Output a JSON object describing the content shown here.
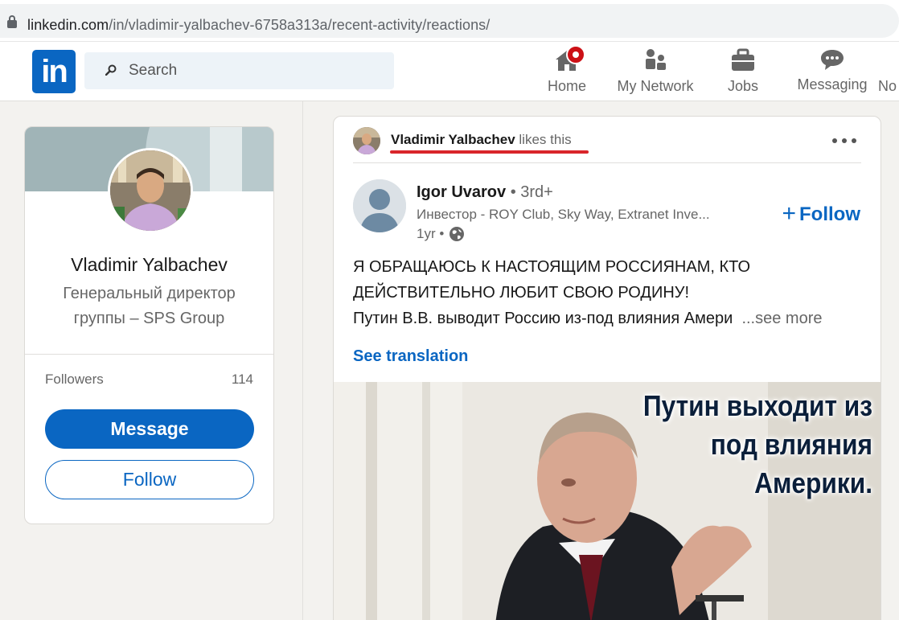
{
  "browser": {
    "url_host": "linkedin.com",
    "url_path": "/in/vladimir-yalbachev-6758a313a/recent-activity/reactions/"
  },
  "nav": {
    "logo_text": "in",
    "search_placeholder": "Search",
    "items": [
      {
        "label": "Home",
        "icon": "home-icon",
        "has_badge": true
      },
      {
        "label": "My Network",
        "icon": "people-icon"
      },
      {
        "label": "Jobs",
        "icon": "briefcase-icon"
      },
      {
        "label": "Messaging",
        "icon": "chat-icon"
      },
      {
        "label": "No",
        "icon": "bell-icon"
      }
    ]
  },
  "profile": {
    "name": "Vladimir Yalbachev",
    "headline": "Генеральный директор группы – SPS Group",
    "followers_label": "Followers",
    "followers_count": "114",
    "message_button": "Message",
    "follow_button": "Follow"
  },
  "post": {
    "context_name": "Vladimir Yalbachev",
    "context_action": "likes this",
    "actor_name": "Igor Uvarov",
    "actor_degree": "• 3rd+",
    "actor_headline": "Инвестор - ROY Club, Sky Way, Extranet Inve...",
    "actor_time": "1yr •",
    "follow_label": "Follow",
    "text_lines": [
      "Я ОБРАЩАЮСЬ К НАСТОЯЩИМ РОССИЯНАМ, КТО",
      "ДЕЙСТВИТЕЛЬНО ЛЮБИТ СВОЮ РОДИНУ!",
      "Путин В.В. выводит Россию из-под влияния Амери"
    ],
    "see_more": "...see more",
    "see_translation": "See translation",
    "image_caption_lines": [
      "Путин выходит из",
      "под влияния",
      "Америки."
    ]
  },
  "colors": {
    "brand": "#0a66c2",
    "highlight_underline": "#d9252a",
    "notification_badge": "#cc1016"
  }
}
